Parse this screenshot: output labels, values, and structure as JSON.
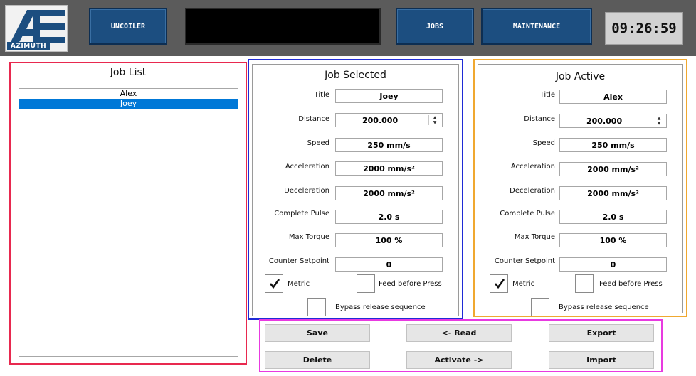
{
  "header": {
    "logo_text": "AZIMUTH",
    "nav": {
      "uncoiler": "UNCOILER",
      "jobs": "JOBS",
      "maintenance": "MAINTENANCE"
    },
    "status_message": "",
    "clock": "09:26:59"
  },
  "job_list": {
    "title": "Job List",
    "items": [
      "Alex",
      "Joey"
    ],
    "selected": "Joey"
  },
  "job_selected": {
    "title": "Job Selected",
    "labels": {
      "title": "Title",
      "distance": "Distance",
      "speed": "Speed",
      "acceleration": "Acceleration",
      "deceleration": "Deceleration",
      "complete_pulse": "Complete  Pulse",
      "max_torque": "Max Torque",
      "counter_setpoint": "Counter Setpoint"
    },
    "values": {
      "title": "Joey",
      "distance": "200.000",
      "speed": "250 mm/s",
      "acceleration": "2000 mm/s²",
      "deceleration": "2000 mm/s²",
      "complete_pulse": "2.0 s",
      "max_torque": "100 %",
      "counter_setpoint": "0"
    },
    "checkboxes": {
      "metric": {
        "label": "Metric",
        "checked": true
      },
      "feed_before_press": {
        "label": "Feed before Press",
        "checked": false
      },
      "bypass_release": {
        "label": "Bypass release sequence",
        "checked": false
      }
    }
  },
  "job_active": {
    "title": "Job Active",
    "labels": {
      "title": "Title",
      "distance": "Distance",
      "speed": "Speed",
      "acceleration": "Acceleration",
      "deceleration": "Deceleration",
      "complete_pulse": "Complete  Pulse",
      "max_torque": "Max Torque",
      "counter_setpoint": "Counter Setpoint"
    },
    "values": {
      "title": "Alex",
      "distance": "200.000",
      "speed": "250 mm/s",
      "acceleration": "2000 mm/s²",
      "deceleration": "2000 mm/s²",
      "complete_pulse": "2.0 s",
      "max_torque": "100 %",
      "counter_setpoint": "0"
    },
    "checkboxes": {
      "metric": {
        "label": "Metric",
        "checked": true
      },
      "feed_before_press": {
        "label": "Feed before Press",
        "checked": false
      },
      "bypass_release": {
        "label": "Bypass release sequence",
        "checked": false
      }
    }
  },
  "actions": {
    "save": "Save",
    "delete": "Delete",
    "read": "<- Read",
    "activate": "Activate ->",
    "export": "Export",
    "import": "Import"
  },
  "colors": {
    "nav_button": "#1c4e80",
    "selection": "#0078d7",
    "job_list_border": "#e8294f",
    "job_selected_border": "#1f2bd6",
    "job_active_border": "#f0a830",
    "actions_border": "#e83ae0"
  }
}
